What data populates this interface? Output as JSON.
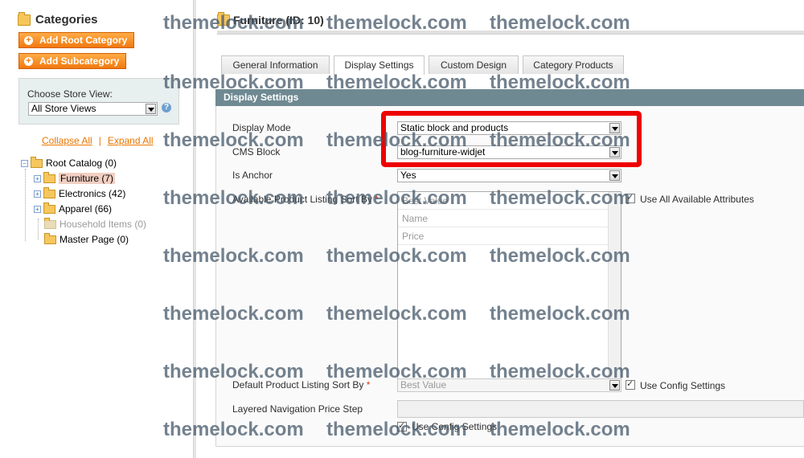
{
  "sidebar": {
    "title": "Categories",
    "add_root_label": "Add Root Category",
    "add_sub_label": "Add Subcategory",
    "store_view_label": "Choose Store View:",
    "store_view_value": "All Store Views",
    "collapse_all": "Collapse All",
    "separator": "|",
    "expand_all": "Expand All",
    "tree": [
      {
        "label": "Root Catalog (0)"
      },
      {
        "label": "Furniture (7)",
        "selected": true
      },
      {
        "label": "Electronics (42)"
      },
      {
        "label": "Apparel (66)"
      },
      {
        "label": "Household Items (0)",
        "disabled": true
      },
      {
        "label": "Master Page (0)"
      }
    ]
  },
  "main": {
    "title": "Furniture (ID: 10)",
    "tabs": [
      {
        "label": "General Information"
      },
      {
        "label": "Display Settings",
        "active": true
      },
      {
        "label": "Custom Design"
      },
      {
        "label": "Category Products"
      }
    ],
    "section_title": "Display Settings",
    "fields": {
      "display_mode_label": "Display Mode",
      "display_mode_value": "Static block and products",
      "cms_block_label": "CMS Block",
      "cms_block_value": "blog-furniture-widjet",
      "is_anchor_label": "Is Anchor",
      "is_anchor_value": "Yes",
      "sort_by_label": "Available Product Listing Sort By",
      "sort_by_options": [
        "Best Value",
        "Name",
        "Price"
      ],
      "use_all_attributes": "Use All Available Attributes",
      "default_sort_label": "Default Product Listing Sort By",
      "default_sort_value": "Best Value",
      "use_config_settings": "Use Config Settings",
      "price_step_label": "Layered Navigation Price Step",
      "use_config_settings_2": "Use Config Settings",
      "required_mark": "*"
    }
  },
  "watermark": "themelock.com",
  "colors": {
    "accent_orange": "#f1790f",
    "section_header": "#6f8992",
    "highlight_red": "#ee0000"
  }
}
